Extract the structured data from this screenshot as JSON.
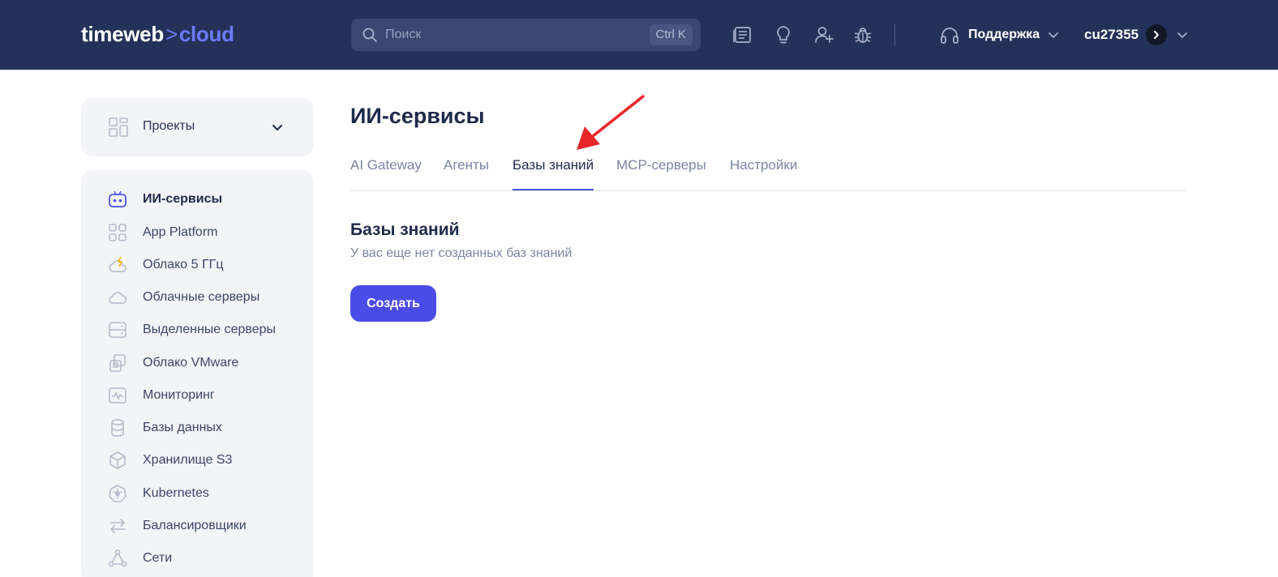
{
  "header": {
    "logo": {
      "part1": "timeweb",
      "sep": ">",
      "part2": "cloud"
    },
    "search": {
      "placeholder": "Поиск",
      "shortcut": "Ctrl K"
    },
    "icons": [
      "docs-icon",
      "lightbulb-icon",
      "add-user-icon",
      "bug-icon"
    ],
    "support_label": "Поддержка",
    "account_label": "cu27355"
  },
  "sidebar": {
    "projects_label": "Проекты",
    "items": [
      {
        "label": "ИИ-сервисы",
        "icon": "ai-robot-icon",
        "active": true
      },
      {
        "label": "App Platform",
        "icon": "apps-grid-icon"
      },
      {
        "label": "Облако 5 ГГц",
        "icon": "cloud-bolt-icon"
      },
      {
        "label": "Облачные серверы",
        "icon": "cloud-icon"
      },
      {
        "label": "Выделенные серверы",
        "icon": "server-icon"
      },
      {
        "label": "Облако VMware",
        "icon": "vmware-icon"
      },
      {
        "label": "Мониторинг",
        "icon": "monitoring-icon"
      },
      {
        "label": "Базы данных",
        "icon": "database-icon"
      },
      {
        "label": "Хранилище S3",
        "icon": "storage-cube-icon"
      },
      {
        "label": "Kubernetes",
        "icon": "kubernetes-icon"
      },
      {
        "label": "Балансировщики",
        "icon": "balancer-arrows-icon"
      },
      {
        "label": "Сети",
        "icon": "network-icon"
      }
    ]
  },
  "main": {
    "title": "ИИ-сервисы",
    "tabs": [
      {
        "label": "AI Gateway"
      },
      {
        "label": "Агенты"
      },
      {
        "label": "Базы знаний",
        "active": true
      },
      {
        "label": "MCP-серверы"
      },
      {
        "label": "Настройки"
      }
    ],
    "section_title": "Базы знаний",
    "section_subtitle": "У вас еще нет созданных баз знаний",
    "create_button": "Создать"
  },
  "colors": {
    "header_bg": "#243259",
    "accent": "#4a4ce8",
    "annotation_arrow": "#e8262a"
  }
}
